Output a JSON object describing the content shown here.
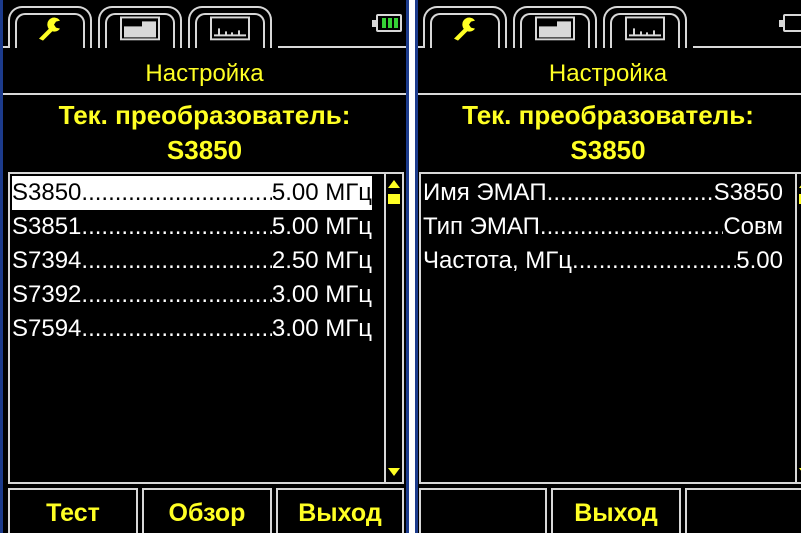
{
  "colors": {
    "background": "#000000",
    "accent_yellow": "#ffff24",
    "text_white": "#ffffff",
    "frame_gray": "#d8d8d8",
    "battery_green": "#35d235",
    "edge_blue": "#1c3b8c"
  },
  "tabs": [
    {
      "icon": "wrench-icon",
      "active": true
    },
    {
      "icon": "bscan-icon",
      "active": false
    },
    {
      "icon": "ascan-icon",
      "active": false
    }
  ],
  "battery_icon": "battery-icon",
  "left_screen": {
    "title": "Настройка",
    "current_label": "Тек. преобразователь:",
    "current_value": "S3850",
    "list": [
      {
        "name": "S3850",
        "value": "5.00 МГц",
        "selected": true
      },
      {
        "name": "S3851",
        "value": "5.00 МГц",
        "selected": false
      },
      {
        "name": "S7394",
        "value": "2.50 МГц",
        "selected": false
      },
      {
        "name": "S7392",
        "value": "3.00 МГц",
        "selected": false
      },
      {
        "name": "S7594",
        "value": "3.00 МГц",
        "selected": false
      }
    ],
    "buttons": [
      "Тест",
      "Обзор",
      "Выход"
    ]
  },
  "right_screen": {
    "title": "Настройка",
    "current_label": "Тек. преобразователь:",
    "current_value": "S3850",
    "params": [
      {
        "name": "Имя ЭМАП",
        "value": "S3850"
      },
      {
        "name": "Тип ЭМАП",
        "value": "Совм"
      },
      {
        "name": "Частота, МГц",
        "value": "5.00"
      }
    ],
    "buttons": [
      "",
      "Выход",
      ""
    ]
  }
}
